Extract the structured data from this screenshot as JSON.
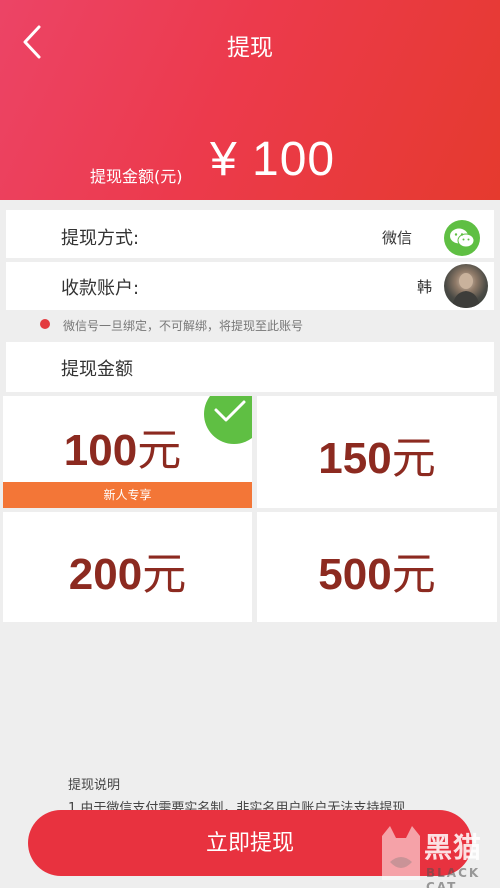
{
  "header": {
    "title": "提现",
    "amount_label": "提现金额(元)",
    "amount_value": "¥ 100"
  },
  "method": {
    "label": "提现方式:",
    "value": "微信",
    "icon": "wechat-icon"
  },
  "account": {
    "label": "收款账户:",
    "name": "韩"
  },
  "notice": {
    "text": "微信号一旦绑定，不可解绑，将提现至此账号"
  },
  "amount_section": {
    "title": "提现金额"
  },
  "options": [
    {
      "amount": "100",
      "unit": "元",
      "tag": "新人专享",
      "selected": true
    },
    {
      "amount": "150",
      "unit": "元"
    },
    {
      "amount": "200",
      "unit": "元"
    },
    {
      "amount": "500",
      "unit": "元"
    }
  ],
  "explain": {
    "title": "提现说明",
    "line1": "1.由于微信支付需要实名制，非实名用户账户无法支持提现"
  },
  "submit": {
    "label": "立即提现"
  },
  "watermark": {
    "cn": "黑猫",
    "en": "BLACK CAT"
  },
  "colors": {
    "header_start": "#ec4466",
    "header_end": "#e53a2e",
    "accent": "#e8323f",
    "amount_text": "#8c2a20",
    "tag": "#f37637",
    "check": "#5fbf43"
  }
}
